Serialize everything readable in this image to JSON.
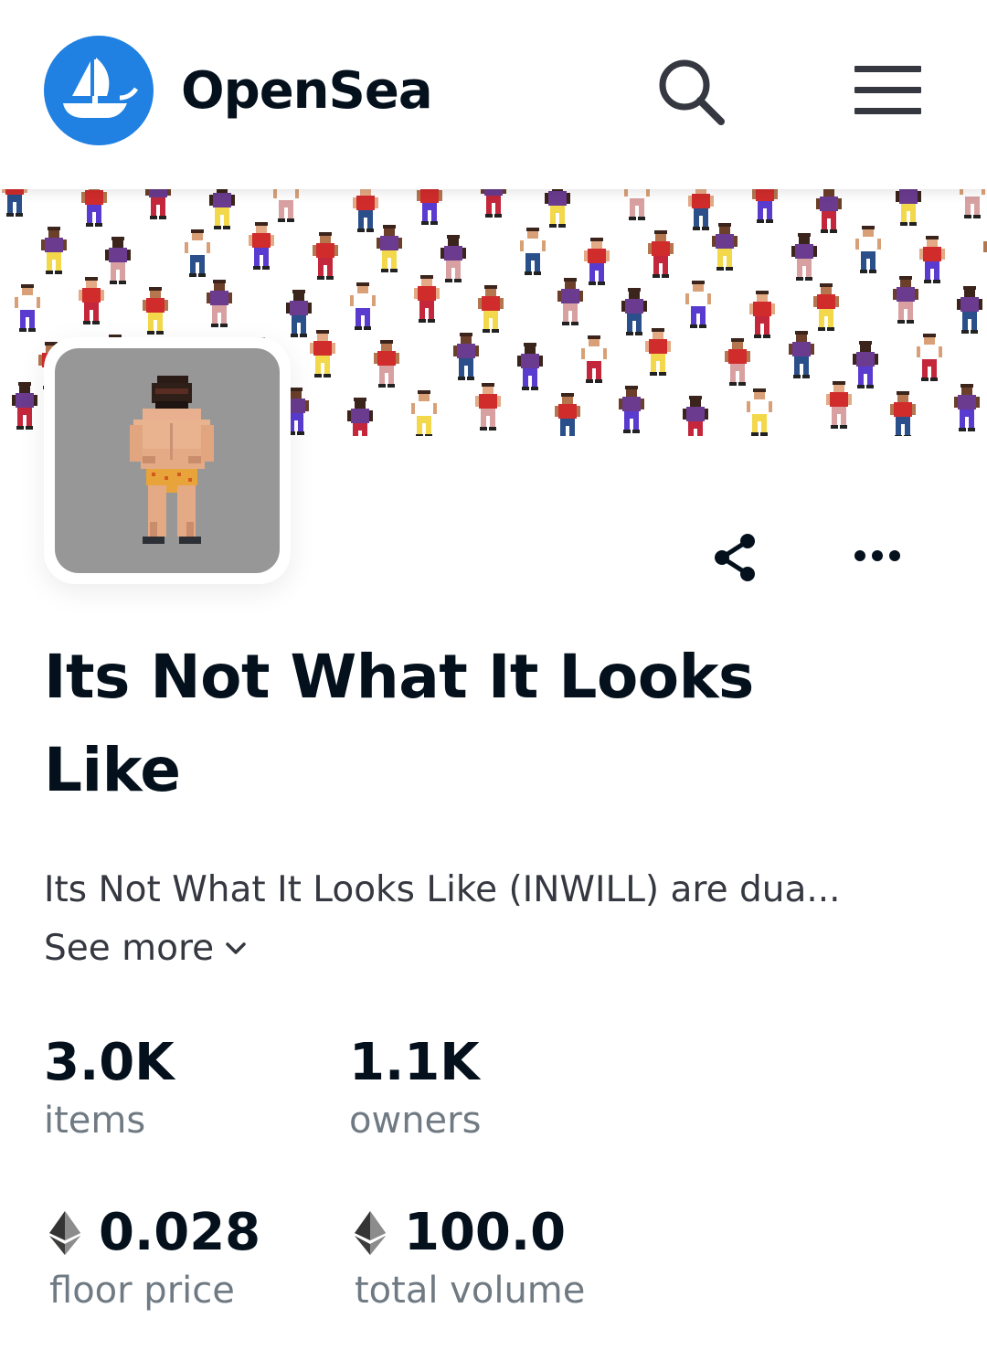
{
  "header": {
    "brand": "OpenSea",
    "icons": [
      "opensea-logo-icon",
      "search-icon",
      "hamburger-menu-icon"
    ]
  },
  "collection": {
    "title": "Its Not What It Looks Like",
    "description": "Its Not What It Looks Like (INWILL) are dua...",
    "see_more": "See more",
    "actions": [
      "share-icon",
      "more-options-icon"
    ]
  },
  "stats": {
    "items": {
      "value": "3.0K",
      "label": "items"
    },
    "owners": {
      "value": "1.1K",
      "label": "owners"
    },
    "floor_price": {
      "value": "0.028",
      "label": "floor price"
    },
    "total_volume": {
      "value": "100.0",
      "label": "total volume"
    }
  },
  "colors": {
    "brand_blue": "#2081e2",
    "text_primary": "#04111d",
    "text_secondary": "#707a83",
    "avatar_bg": "#979797"
  }
}
